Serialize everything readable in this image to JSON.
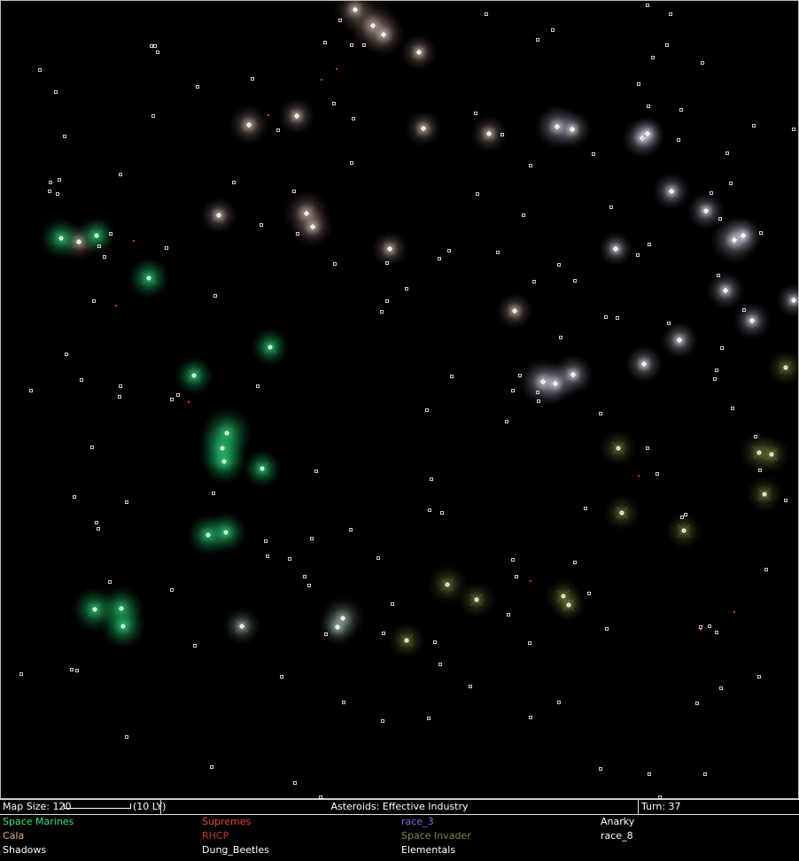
{
  "status_bar": {
    "map_size_label": "Map Size: 120",
    "scale_label": "(10 LY)",
    "center_text": "Asteroids: Effective Industry",
    "turn_label": "Turn: 37"
  },
  "legend": [
    {
      "name": "Space Marines",
      "color": "#2ee878"
    },
    {
      "name": "Supremes",
      "color": "#e0483a"
    },
    {
      "name": "race_3",
      "color": "#7a6cf0"
    },
    {
      "name": "Anarky",
      "color": "#ffffff"
    },
    {
      "name": "Cala",
      "color": "#d8b58a"
    },
    {
      "name": "RHCP",
      "color": "#c0392b"
    },
    {
      "name": "Space Invader",
      "color": "#7f8a3a"
    },
    {
      "name": "race_8",
      "color": "#ffffff"
    },
    {
      "name": "Shadows",
      "color": "#ffffff"
    },
    {
      "name": "Dung_Beetles",
      "color": "#ffffff"
    },
    {
      "name": "Elementals",
      "color": "#ffffff"
    }
  ],
  "colors": {
    "background": "#000000",
    "planet_dot": "#ffffff",
    "ship_marker": "#ff2a2a",
    "glow_green": "#2ee878",
    "glow_white": "#ffffff",
    "glow_olive": "#9aa04a",
    "glow_pink": "#e8cfc4"
  }
}
